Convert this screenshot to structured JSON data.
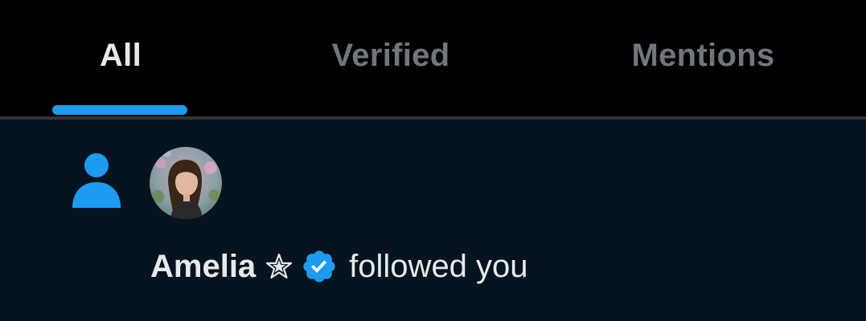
{
  "tabs": [
    {
      "label": "All",
      "active": true
    },
    {
      "label": "Verified",
      "active": false
    },
    {
      "label": "Mentions",
      "active": false
    }
  ],
  "notification": {
    "type_icon": "person-follow-icon",
    "avatar": "user-avatar-photo",
    "user_name": "Amelia",
    "name_emoji": "star-icon",
    "badge": "verified-badge-icon",
    "action": "followed you"
  },
  "colors": {
    "accent": "#1d9bf0",
    "background": "#000000",
    "notification_bg": "#061420",
    "text_primary": "#e7e9ea",
    "text_secondary": "#71767b"
  }
}
